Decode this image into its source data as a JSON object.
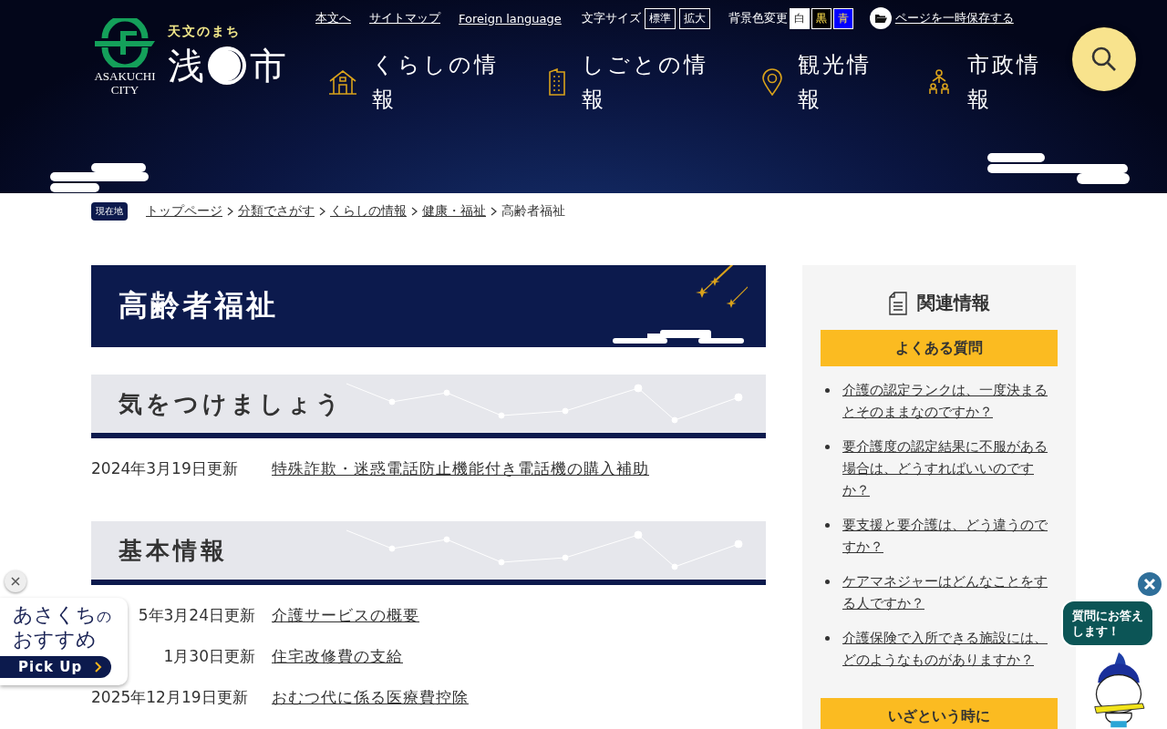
{
  "utility_links": [
    {
      "label": "本文へ"
    },
    {
      "label": "サイトマップ"
    },
    {
      "label": "Foreign language"
    }
  ],
  "font_size": {
    "label": "文字サイズ",
    "options": [
      {
        "label": "標準",
        "selected": false
      },
      {
        "label": "拡大",
        "selected": false
      }
    ]
  },
  "bg_color": {
    "label": "背景色変更",
    "options": [
      {
        "label": "白",
        "color": "#ffffff"
      },
      {
        "label": "黒",
        "color": "#000000"
      },
      {
        "label": "青",
        "color": "#0000ff"
      }
    ]
  },
  "save_page": {
    "label": "ページを一時保存する"
  },
  "logo": {
    "tagline": "天文のまち",
    "city_en": "ASAKUCHI CITY",
    "name_first": "浅",
    "name_last": "市"
  },
  "nav": [
    {
      "label": "くらしの情報",
      "kind": "house"
    },
    {
      "label": "しごとの情報",
      "kind": "building"
    },
    {
      "label": "観光情報",
      "kind": "pin"
    },
    {
      "label": "市政情報",
      "kind": "people"
    }
  ],
  "breadcrumb": {
    "badge": "現在地",
    "links": [
      "トップページ",
      "分類でさがす",
      "くらしの情報",
      "健康・福祉"
    ],
    "current": "高齢者福祉"
  },
  "page_title": "高齢者福祉",
  "sections": [
    {
      "heading": "気をつけましょう",
      "items": [
        {
          "date": "2024年3月19日更新",
          "title": "特殊詐欺・迷惑電話防止機能付き電話機の購入補助"
        }
      ]
    },
    {
      "heading": "基本情報",
      "items": [
        {
          "date": "5年3月24日更新",
          "title": "介護サービスの概要"
        },
        {
          "date": "1月30日更新",
          "title": "住宅改修費の支給"
        },
        {
          "date": "2025年12月19日更新",
          "title": "おむつ代に係る医療費控除"
        }
      ]
    }
  ],
  "sidebar": {
    "title": "関連情報",
    "groups": [
      {
        "heading": "よくある質問",
        "links": [
          "介護の認定ランクは、一度決まるとそのままなのですか？",
          "要介護度の認定結果に不服がある場合は、どうすればいいのですか？",
          "要支援と要介護は、どう違うのですか？",
          "ケアマネジャーはどんなことをする人ですか？",
          "介護保険で入所できる施設には、どのようなものがありますか？"
        ]
      },
      {
        "heading": "いざという時に"
      }
    ]
  },
  "pickup": {
    "title": "あさくち",
    "title_small": "の",
    "subtitle": "おすすめ",
    "button": "Pick Up"
  },
  "assistant": {
    "bubble": "質問にお答えします！"
  }
}
